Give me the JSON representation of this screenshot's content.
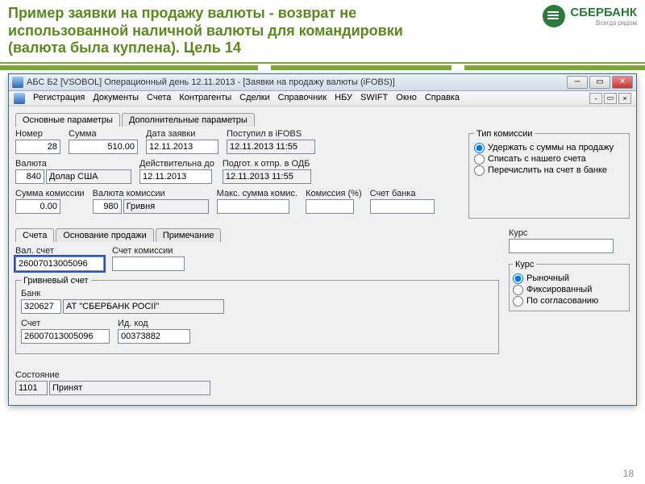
{
  "slide": {
    "title": "Пример заявки на продажу валюты - возврат не использованной наличной валюты для командировки (валюта была куплена). Цель 14",
    "logo_name": "СБЕРБАНК",
    "logo_tag": "Всегда рядом",
    "page_num": "18"
  },
  "window": {
    "title": "АБС Б2 [VSOBOL] Операционный день 12.11.2013 - [Заявки на продажу валюты (iFOBS)]"
  },
  "menu": {
    "items": [
      "Регистрация",
      "Документы",
      "Счета",
      "Контрагенты",
      "Сделки",
      "Справочник",
      "НБУ",
      "SWIFT",
      "Окно",
      "Справка"
    ]
  },
  "tabs": {
    "main": "Основные параметры",
    "extra": "Дополнительные параметры"
  },
  "fields": {
    "number_lbl": "Номер",
    "number": "28",
    "sum_lbl": "Сумма",
    "sum": "510.00",
    "date_lbl": "Дата заявки",
    "date": "12.11.2013",
    "ifobs_lbl": "Поступил в iFOBS",
    "ifobs": "12.11.2013 11:55",
    "currency_lbl": "Валюта",
    "curr_code": "840",
    "curr_name": "Долар США",
    "valid_lbl": "Действительна до",
    "valid": "12.11.2013",
    "odb_lbl": "Подгот. к отпр. в ОДБ",
    "odb": "12.11.2013 11:55",
    "comm_sum_lbl": "Сумма комиссии",
    "comm_sum": "0.00",
    "comm_curr_lbl": "Валюта комиссии",
    "comm_curr_code": "980",
    "comm_curr_name": "Гривня",
    "max_comm_lbl": "Макс. сумма комис.",
    "max_comm": "",
    "comm_pct_lbl": "Комиссия (%)",
    "comm_pct": "",
    "bank_acc_lbl": "Счет банка",
    "bank_acc": ""
  },
  "commission": {
    "legend": "Тип комиссии",
    "opt1": "Удержать с суммы на продажу",
    "opt2": "Списать с нашего счета",
    "opt3": "Перечислить на счет в банке"
  },
  "subtabs": {
    "accounts": "Счета",
    "basis": "Основание продажи",
    "note": "Примечание"
  },
  "accounts": {
    "val_acc_lbl": "Вал. счет",
    "val_acc": "26007013005096",
    "comm_acc_lbl": "Счет комиссии",
    "comm_acc": "",
    "uah_legend": "Гривневый счет",
    "bank_lbl": "Банк",
    "bank_code": "320627",
    "bank_name": "АТ \"СБЕРБАНК РОСІЇ\"",
    "acc_lbl": "Счет",
    "acc": "26007013005096",
    "id_lbl": "Ид. код",
    "id": "00373882"
  },
  "state": {
    "code_lbl": "Состояние",
    "code": "1101",
    "name": "Принят"
  },
  "kurs": {
    "title": "Курс",
    "value": "",
    "sub_legend": "Курс",
    "opt1": "Рыночный",
    "opt2": "Фиксированный",
    "opt3": "По согласованию"
  }
}
